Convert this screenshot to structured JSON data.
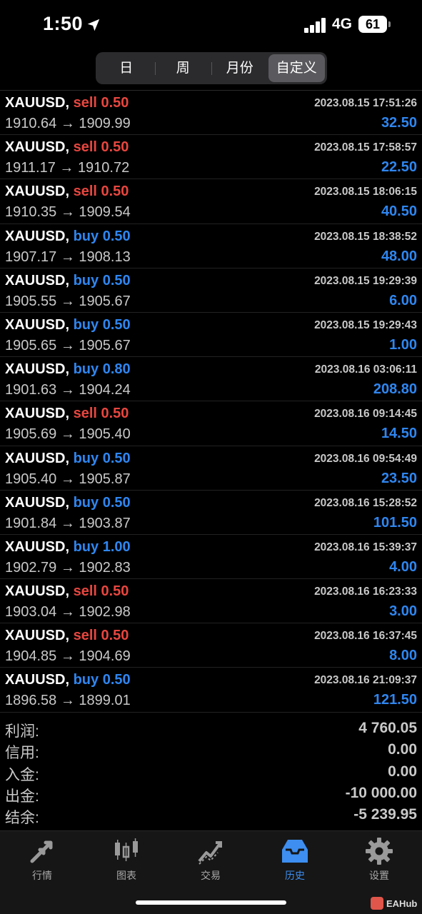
{
  "status": {
    "time": "1:50",
    "network": "4G",
    "battery": "61"
  },
  "segments": [
    {
      "label": "日",
      "active": false
    },
    {
      "label": "周",
      "active": false
    },
    {
      "label": "月份",
      "active": false
    },
    {
      "label": "自定义",
      "active": true
    }
  ],
  "trades": [
    {
      "symbol": "XAUUSD,",
      "type": "sell",
      "volume": "0.50",
      "datetime": "2023.08.15 17:51:26",
      "open_price": "1910.64",
      "close_price": "1909.99",
      "profit": "32.50"
    },
    {
      "symbol": "XAUUSD,",
      "type": "sell",
      "volume": "0.50",
      "datetime": "2023.08.15 17:58:57",
      "open_price": "1911.17",
      "close_price": "1910.72",
      "profit": "22.50"
    },
    {
      "symbol": "XAUUSD,",
      "type": "sell",
      "volume": "0.50",
      "datetime": "2023.08.15 18:06:15",
      "open_price": "1910.35",
      "close_price": "1909.54",
      "profit": "40.50"
    },
    {
      "symbol": "XAUUSD,",
      "type": "buy",
      "volume": "0.50",
      "datetime": "2023.08.15 18:38:52",
      "open_price": "1907.17",
      "close_price": "1908.13",
      "profit": "48.00"
    },
    {
      "symbol": "XAUUSD,",
      "type": "buy",
      "volume": "0.50",
      "datetime": "2023.08.15 19:29:39",
      "open_price": "1905.55",
      "close_price": "1905.67",
      "profit": "6.00"
    },
    {
      "symbol": "XAUUSD,",
      "type": "buy",
      "volume": "0.50",
      "datetime": "2023.08.15 19:29:43",
      "open_price": "1905.65",
      "close_price": "1905.67",
      "profit": "1.00"
    },
    {
      "symbol": "XAUUSD,",
      "type": "buy",
      "volume": "0.80",
      "datetime": "2023.08.16 03:06:11",
      "open_price": "1901.63",
      "close_price": "1904.24",
      "profit": "208.80"
    },
    {
      "symbol": "XAUUSD,",
      "type": "sell",
      "volume": "0.50",
      "datetime": "2023.08.16 09:14:45",
      "open_price": "1905.69",
      "close_price": "1905.40",
      "profit": "14.50"
    },
    {
      "symbol": "XAUUSD,",
      "type": "buy",
      "volume": "0.50",
      "datetime": "2023.08.16 09:54:49",
      "open_price": "1905.40",
      "close_price": "1905.87",
      "profit": "23.50"
    },
    {
      "symbol": "XAUUSD,",
      "type": "buy",
      "volume": "0.50",
      "datetime": "2023.08.16 15:28:52",
      "open_price": "1901.84",
      "close_price": "1903.87",
      "profit": "101.50"
    },
    {
      "symbol": "XAUUSD,",
      "type": "buy",
      "volume": "1.00",
      "datetime": "2023.08.16 15:39:37",
      "open_price": "1902.79",
      "close_price": "1902.83",
      "profit": "4.00"
    },
    {
      "symbol": "XAUUSD,",
      "type": "sell",
      "volume": "0.50",
      "datetime": "2023.08.16 16:23:33",
      "open_price": "1903.04",
      "close_price": "1902.98",
      "profit": "3.00"
    },
    {
      "symbol": "XAUUSD,",
      "type": "sell",
      "volume": "0.50",
      "datetime": "2023.08.16 16:37:45",
      "open_price": "1904.85",
      "close_price": "1904.69",
      "profit": "8.00"
    },
    {
      "symbol": "XAUUSD,",
      "type": "buy",
      "volume": "0.50",
      "datetime": "2023.08.16 21:09:37",
      "open_price": "1896.58",
      "close_price": "1899.01",
      "profit": "121.50"
    }
  ],
  "arrow": "→",
  "summary": [
    {
      "label": "利润:",
      "value": "4 760.05"
    },
    {
      "label": "信用:",
      "value": "0.00"
    },
    {
      "label": "入金:",
      "value": "0.00"
    },
    {
      "label": "出金:",
      "value": "-10 000.00"
    },
    {
      "label": "结余:",
      "value": "-5 239.95"
    }
  ],
  "tabs": [
    {
      "label": "行情",
      "icon": "quotes-arrows-icon",
      "active": false
    },
    {
      "label": "图表",
      "icon": "candlestick-chart-icon",
      "active": false
    },
    {
      "label": "交易",
      "icon": "trade-chart-icon",
      "active": false
    },
    {
      "label": "历史",
      "icon": "history-inbox-icon",
      "active": true
    },
    {
      "label": "设置",
      "icon": "gear-icon",
      "active": false
    }
  ],
  "watermark": "EAHub",
  "colors": {
    "sell": "#e8463f",
    "buy": "#2f86f0",
    "profit": "#2f86f0",
    "active_tab": "#3d8ef0"
  }
}
